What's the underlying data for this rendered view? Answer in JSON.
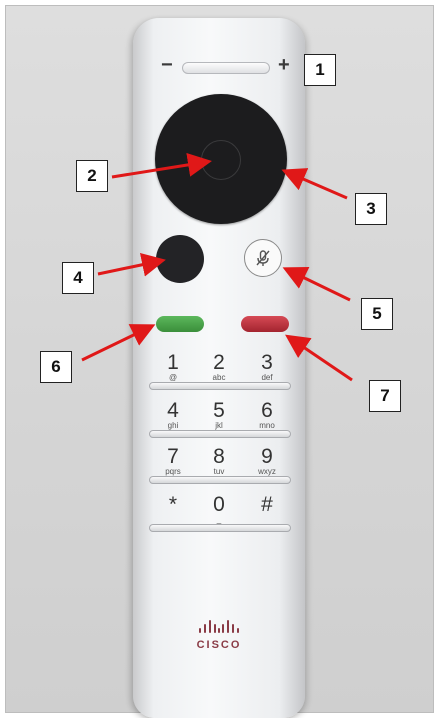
{
  "remote": {
    "volume": {
      "minus": "−",
      "plus": "+"
    },
    "keypad": [
      {
        "num": "1",
        "sub": "@"
      },
      {
        "num": "2",
        "sub": "abc"
      },
      {
        "num": "3",
        "sub": "def"
      },
      {
        "num": "4",
        "sub": "ghi"
      },
      {
        "num": "5",
        "sub": "jkl"
      },
      {
        "num": "6",
        "sub": "mno"
      },
      {
        "num": "7",
        "sub": "pqrs"
      },
      {
        "num": "8",
        "sub": "tuv"
      },
      {
        "num": "9",
        "sub": "wxyz"
      },
      {
        "num": "*",
        "sub": ""
      },
      {
        "num": "0",
        "sub": "_"
      },
      {
        "num": "#",
        "sub": ""
      }
    ],
    "brand": "CISCO",
    "colors": {
      "call": "#4aa84a",
      "end_call": "#c0343f",
      "touchpad": "#1c1c1e",
      "arrow": "#e01818"
    }
  },
  "callouts": [
    "1",
    "2",
    "3",
    "4",
    "5",
    "6",
    "7"
  ]
}
